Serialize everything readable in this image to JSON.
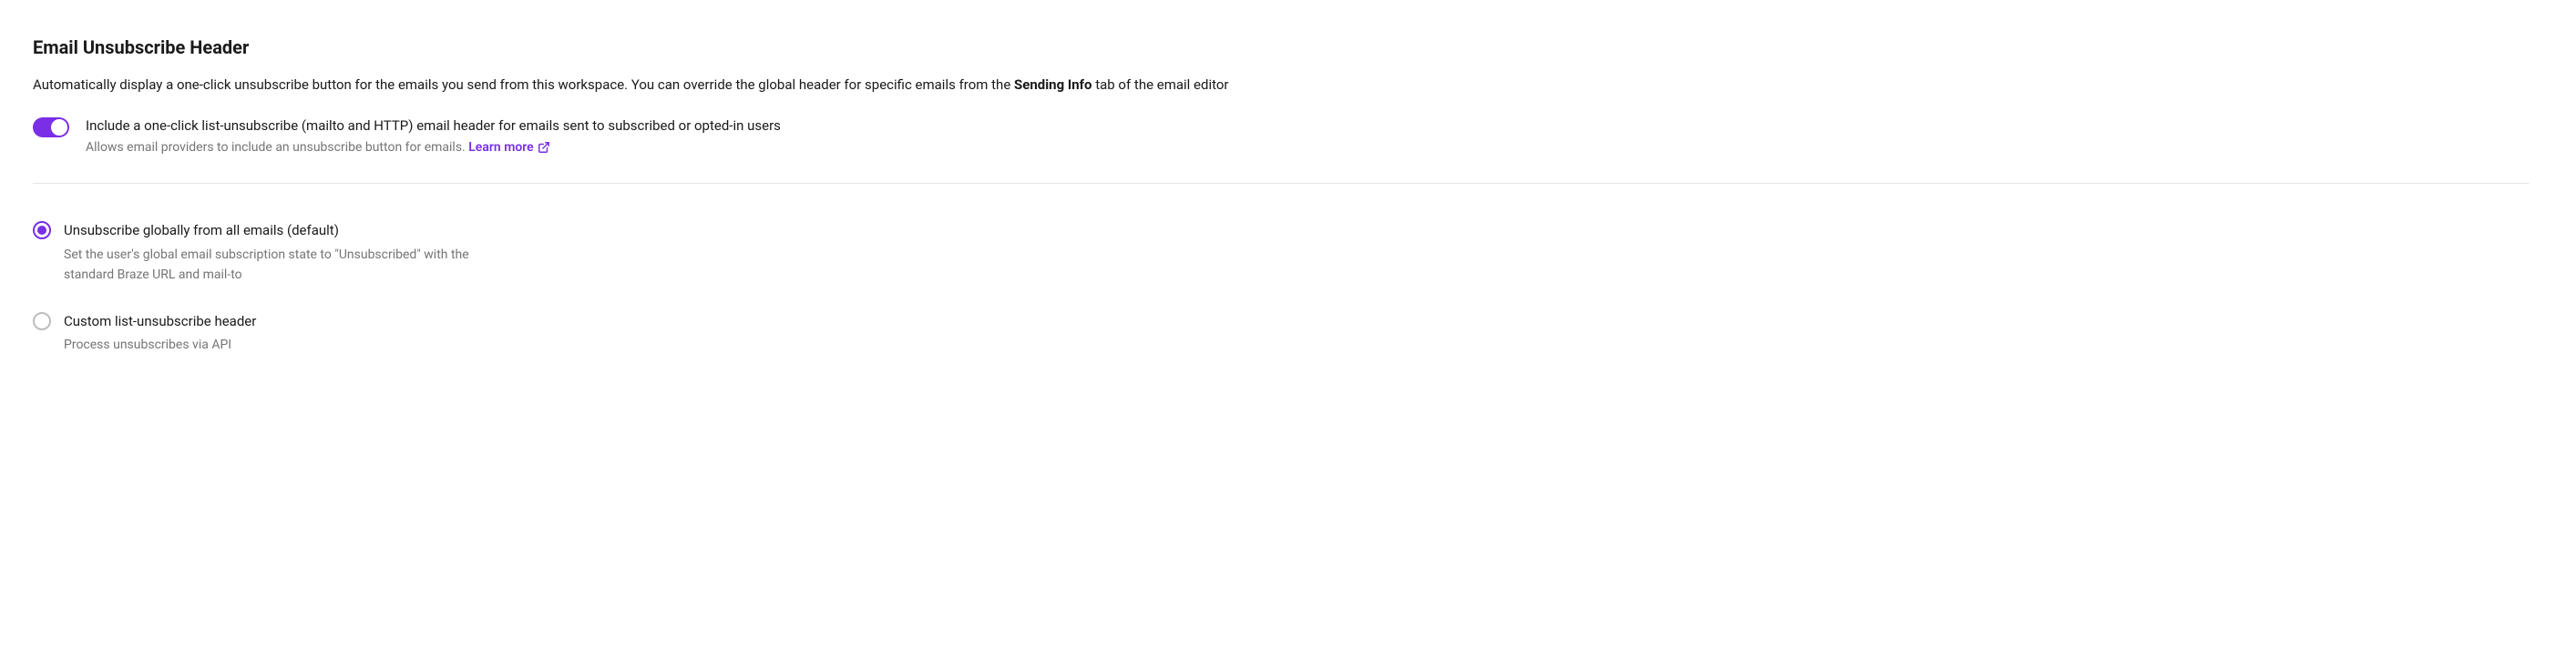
{
  "section": {
    "title": "Email Unsubscribe Header",
    "description_pre": "Automatically display a one-click unsubscribe button for the emails you send from this workspace. You can override the global header for specific emails from the ",
    "description_bold": "Sending Info",
    "description_post": " tab of the email editor"
  },
  "toggle": {
    "enabled": true,
    "label": "Include a one-click list-unsubscribe (mailto and HTTP) email header for emails sent to subscribed or opted-in users",
    "sublabel": "Allows email providers to include an unsubscribe button for emails. ",
    "learn_more": "Learn more"
  },
  "radio_options": [
    {
      "id": "global",
      "selected": true,
      "label": "Unsubscribe globally from all emails (default)",
      "sublabel": "Set the user's global email subscription state to \"Unsubscribed\" with the standard Braze URL and mail-to"
    },
    {
      "id": "custom",
      "selected": false,
      "label": "Custom list-unsubscribe header",
      "sublabel": "Process unsubscribes via API"
    }
  ],
  "colors": {
    "accent": "#7A2EE6"
  }
}
